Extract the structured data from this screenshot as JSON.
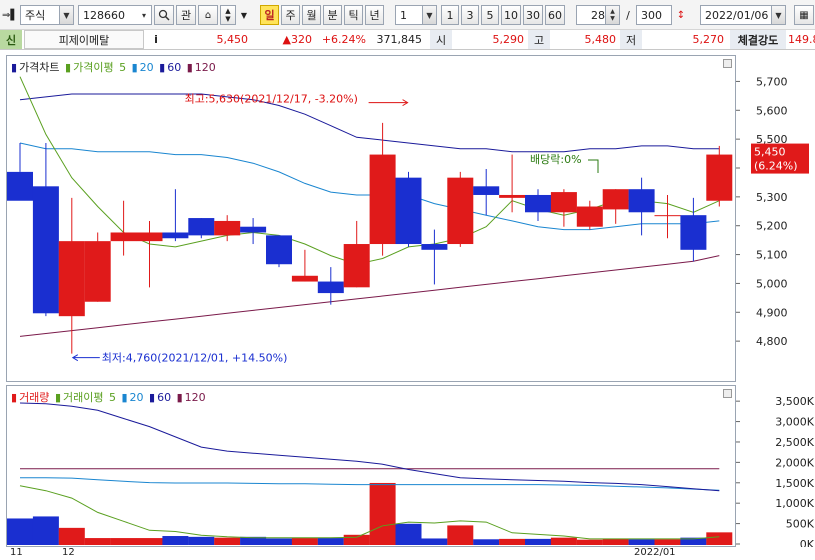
{
  "toolbar": {
    "market_type": "주식",
    "stock_code": "128660",
    "kwan_label": "관",
    "periods": [
      "일",
      "주",
      "월",
      "분",
      "틱",
      "년"
    ],
    "selected_period": "일",
    "interval_value": "1",
    "quick_intervals": [
      "1",
      "3",
      "5",
      "10",
      "30",
      "60"
    ],
    "data_count": "28",
    "separator": "/",
    "max_count": "300",
    "date": "2022/01/06"
  },
  "info": {
    "credit_badge": "신",
    "stock_name": "피제이메탈",
    "info_icon": "i",
    "price": "5,450",
    "change": "▲320",
    "change_pct": "+6.24%",
    "volume": "371,845",
    "open_label": "시",
    "open": "5,290",
    "high_label": "고",
    "high": "5,480",
    "low_label": "저",
    "low": "5,270",
    "strength_label": "체결강도",
    "strength": "149.8"
  },
  "price_legend": {
    "title": "가격차트",
    "ma_label": "가격이평",
    "ma_periods": [
      "5",
      "20",
      "60",
      "120"
    ]
  },
  "volume_legend": {
    "title": "거래량",
    "ma_label": "거래이평",
    "ma_periods": [
      "5",
      "20",
      "60",
      "120"
    ]
  },
  "colors": {
    "up": "#e01a1a",
    "down": "#1a2fd0",
    "ma5": "#5aa020",
    "ma20": "#1a86d0",
    "ma60": "#1a1a9a",
    "ma120": "#7a1a4a"
  },
  "annotations": {
    "high": "최고:5,630(2021/12/17, -3.20%)",
    "low": "최저:4,760(2021/12/01, +14.50%)",
    "dividend": "배당락:0%",
    "current_price": "5,450",
    "current_pct": "(6.24%)"
  },
  "chart_data": {
    "type": "candlestick",
    "price_axis_ticks": [
      "5,700",
      "5,600",
      "5,500",
      "5,400",
      "5,300",
      "5,200",
      "5,100",
      "5,000",
      "4,900",
      "4,800"
    ],
    "volume_axis_ticks": [
      "3,500K",
      "3,000K",
      "2,500K",
      "2,000K",
      "1,500K",
      "1,000K",
      "500K",
      "0K"
    ],
    "date_labels": [
      "11",
      "12",
      "2022/01"
    ],
    "candles": [
      {
        "o": 5390,
        "h": 5490,
        "l": 5390,
        "c": 5290
      },
      {
        "o": 5340,
        "h": 5490,
        "l": 4890,
        "c": 4900
      },
      {
        "o": 4890,
        "h": 5300,
        "l": 4760,
        "c": 5150
      },
      {
        "o": 4940,
        "h": 5180,
        "l": 4940,
        "c": 5150
      },
      {
        "o": 5150,
        "h": 5290,
        "l": 5100,
        "c": 5180
      },
      {
        "o": 5150,
        "h": 5220,
        "l": 4990,
        "c": 5180
      },
      {
        "o": 5180,
        "h": 5330,
        "l": 5150,
        "c": 5160
      },
      {
        "o": 5230,
        "h": 5230,
        "l": 5160,
        "c": 5170
      },
      {
        "o": 5170,
        "h": 5240,
        "l": 5150,
        "c": 5220
      },
      {
        "o": 5200,
        "h": 5230,
        "l": 5140,
        "c": 5180
      },
      {
        "o": 5170,
        "h": 5170,
        "l": 5060,
        "c": 5070
      },
      {
        "o": 5010,
        "h": 5120,
        "l": 5010,
        "c": 5030
      },
      {
        "o": 5010,
        "h": 5060,
        "l": 4930,
        "c": 4970
      },
      {
        "o": 4990,
        "h": 5220,
        "l": 4990,
        "c": 5140
      },
      {
        "o": 5140,
        "h": 5560,
        "l": 5100,
        "c": 5450
      },
      {
        "o": 5370,
        "h": 5390,
        "l": 5130,
        "c": 5140
      },
      {
        "o": 5140,
        "h": 5190,
        "l": 5000,
        "c": 5120
      },
      {
        "o": 5140,
        "h": 5390,
        "l": 5130,
        "c": 5370
      },
      {
        "o": 5340,
        "h": 5400,
        "l": 5240,
        "c": 5310
      },
      {
        "o": 5300,
        "h": 5450,
        "l": 5250,
        "c": 5310
      },
      {
        "o": 5310,
        "h": 5330,
        "l": 5220,
        "c": 5250
      },
      {
        "o": 5250,
        "h": 5330,
        "l": 5200,
        "c": 5320
      },
      {
        "o": 5200,
        "h": 5290,
        "l": 5190,
        "c": 5270
      },
      {
        "o": 5260,
        "h": 5330,
        "l": 5210,
        "c": 5330
      },
      {
        "o": 5330,
        "h": 5370,
        "l": 5170,
        "c": 5250
      },
      {
        "o": 5240,
        "h": 5310,
        "l": 5160,
        "c": 5240
      },
      {
        "o": 5240,
        "h": 5300,
        "l": 5080,
        "c": 5120
      },
      {
        "o": 5290,
        "h": 5480,
        "l": 5270,
        "c": 5450
      }
    ],
    "ma5": [
      5720,
      5520,
      5370,
      5270,
      5180,
      5140,
      5130,
      5150,
      5170,
      5180,
      5170,
      5140,
      5100,
      5070,
      5090,
      5130,
      5140,
      5160,
      5200,
      5290,
      5260,
      5240,
      5260,
      5290,
      5290,
      5280,
      5250,
      5290
    ],
    "ma20": [
      5490,
      5470,
      5470,
      5460,
      5460,
      5460,
      5450,
      5450,
      5440,
      5420,
      5390,
      5350,
      5320,
      5310,
      5310,
      5310,
      5280,
      5260,
      5240,
      5220,
      5200,
      5190,
      5190,
      5200,
      5210,
      5210,
      5210,
      5220
    ],
    "ma60": [
      5640,
      5650,
      5660,
      5660,
      5660,
      5660,
      5660,
      5660,
      5650,
      5640,
      5620,
      5590,
      5550,
      5510,
      5500,
      5490,
      5480,
      5470,
      5470,
      5460,
      5460,
      5460,
      5470,
      5470,
      5480,
      5480,
      5470,
      5470
    ],
    "ma120": [
      4820,
      4830,
      4840,
      4850,
      4860,
      4870,
      4880,
      4890,
      4900,
      4910,
      4920,
      4930,
      4940,
      4950,
      4960,
      4970,
      4980,
      4990,
      5000,
      5010,
      5020,
      5030,
      5040,
      5050,
      5060,
      5070,
      5080,
      5100
    ],
    "volumes": [
      650,
      700,
      420,
      170,
      170,
      170,
      220,
      200,
      180,
      200,
      160,
      170,
      170,
      250,
      1520,
      520,
      160,
      480,
      140,
      150,
      150,
      180,
      130,
      150,
      140,
      140,
      180,
      310
    ],
    "vma5": [
      1450,
      1330,
      1150,
      800,
      580,
      360,
      330,
      240,
      200,
      180,
      180,
      180,
      180,
      190,
      470,
      560,
      540,
      590,
      560,
      300,
      260,
      220,
      150,
      150,
      150,
      150,
      150,
      200
    ],
    "vma20": [
      3480,
      3460,
      3400,
      3300,
      3100,
      2900,
      2650,
      2400,
      2300,
      2250,
      2200,
      2150,
      2100,
      2050,
      1980,
      1850,
      1750,
      1650,
      1620,
      1600,
      1580,
      1560,
      1530,
      1510,
      1480,
      1430,
      1380,
      1330
    ],
    "vma60": [
      1650,
      1650,
      1640,
      1600,
      1560,
      1530,
      1520,
      1520,
      1520,
      1510,
      1500,
      1500,
      1490,
      1480,
      1480,
      1480,
      1480,
      1480,
      1480,
      1480,
      1480,
      1470,
      1460,
      1440,
      1420,
      1400,
      1370,
      1340
    ],
    "vma120": [
      1870,
      1870,
      1870,
      1870,
      1870,
      1870,
      1870,
      1870,
      1870,
      1870,
      1870,
      1870,
      1870,
      1870,
      1870,
      1870,
      1870,
      1870,
      1870,
      1870,
      1870,
      1870,
      1870,
      1870,
      1870,
      1870,
      1870,
      1870
    ],
    "price_ylim": [
      4700,
      5750
    ],
    "volume_ylim": [
      0,
      3700
    ]
  }
}
